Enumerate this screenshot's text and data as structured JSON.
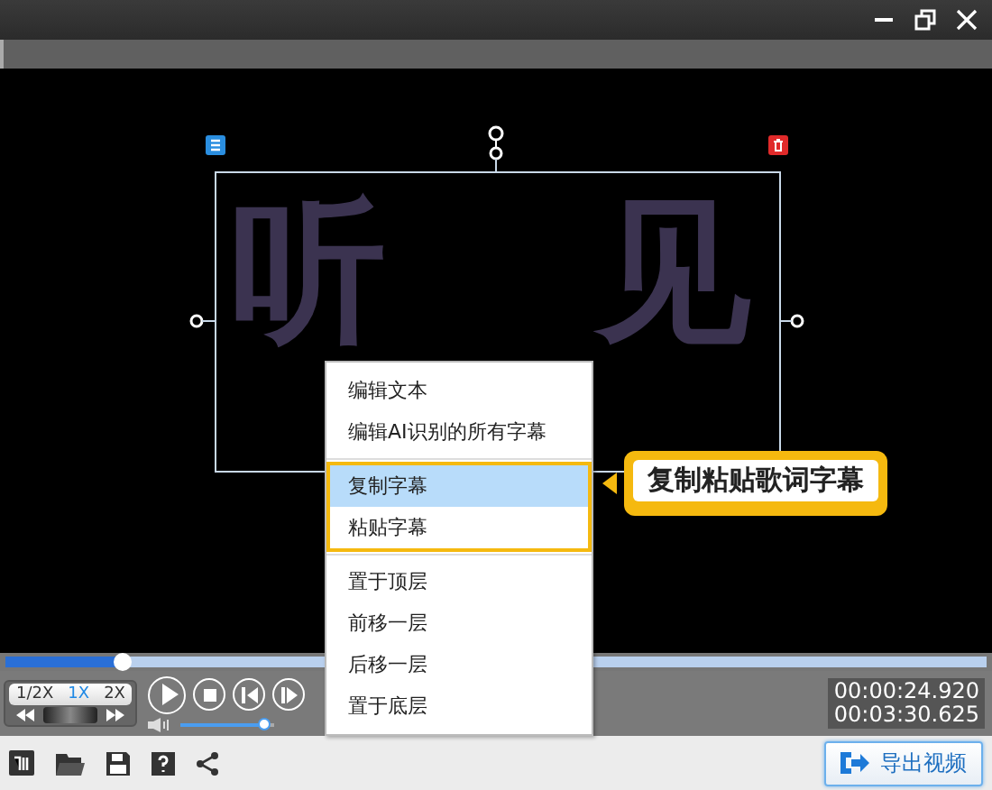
{
  "subtitle": {
    "glyphs": [
      "听",
      "见"
    ],
    "selected": true
  },
  "context_menu": {
    "groups": [
      {
        "highlighted": false,
        "items": [
          {
            "label": "编辑文本",
            "selected": false
          },
          {
            "label": "编辑AI识别的所有字幕",
            "selected": false
          }
        ]
      },
      {
        "highlighted": true,
        "items": [
          {
            "label": "复制字幕",
            "selected": true
          },
          {
            "label": "粘贴字幕",
            "selected": false
          }
        ]
      },
      {
        "highlighted": false,
        "items": [
          {
            "label": "置于顶层",
            "selected": false
          },
          {
            "label": "前移一层",
            "selected": false
          },
          {
            "label": "后移一层",
            "selected": false
          },
          {
            "label": "置于底层",
            "selected": false
          }
        ]
      }
    ]
  },
  "callout": {
    "text": "复制粘贴歌词字幕"
  },
  "progress": {
    "level": 0.12
  },
  "speeds": [
    {
      "label": "1/2X",
      "selected": false
    },
    {
      "label": "1X",
      "selected": true
    },
    {
      "label": "2X",
      "selected": false
    }
  ],
  "volume": {
    "level": 0.9
  },
  "time": {
    "current": "00:00:24.920",
    "total": "00:03:30.625"
  },
  "export_button": {
    "label": "导出视频"
  }
}
